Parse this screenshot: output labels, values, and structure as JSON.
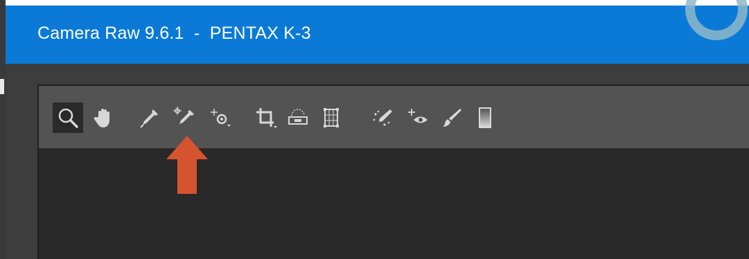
{
  "window": {
    "title": "Camera Raw 9.6.1  -  PENTAX K-3"
  },
  "colors": {
    "titlebar": "#0a7ad6",
    "toolbar": "#535353",
    "panel": "#292929",
    "arrow": "#d6532f",
    "icon": "#d8d8d8"
  },
  "toolbar": {
    "tools": [
      {
        "name": "zoom-tool",
        "icon": "zoom-icon",
        "selected": true
      },
      {
        "name": "hand-tool",
        "icon": "hand-icon"
      },
      {
        "name": "white-balance-tool",
        "icon": "eyedropper-icon",
        "highlighted": true
      },
      {
        "name": "color-sampler-tool",
        "icon": "color-sampler-icon"
      },
      {
        "name": "targeted-adjustment-tool",
        "icon": "targeted-adjustment-icon"
      },
      {
        "name": "crop-tool",
        "icon": "crop-icon"
      },
      {
        "name": "straighten-tool",
        "icon": "straighten-icon"
      },
      {
        "name": "transform-tool",
        "icon": "transform-icon"
      },
      {
        "name": "spot-removal-tool",
        "icon": "spot-removal-icon"
      },
      {
        "name": "red-eye-tool",
        "icon": "red-eye-icon"
      },
      {
        "name": "adjustment-brush-tool",
        "icon": "brush-icon"
      },
      {
        "name": "graduated-filter-tool",
        "icon": "graduated-filter-icon"
      }
    ]
  }
}
